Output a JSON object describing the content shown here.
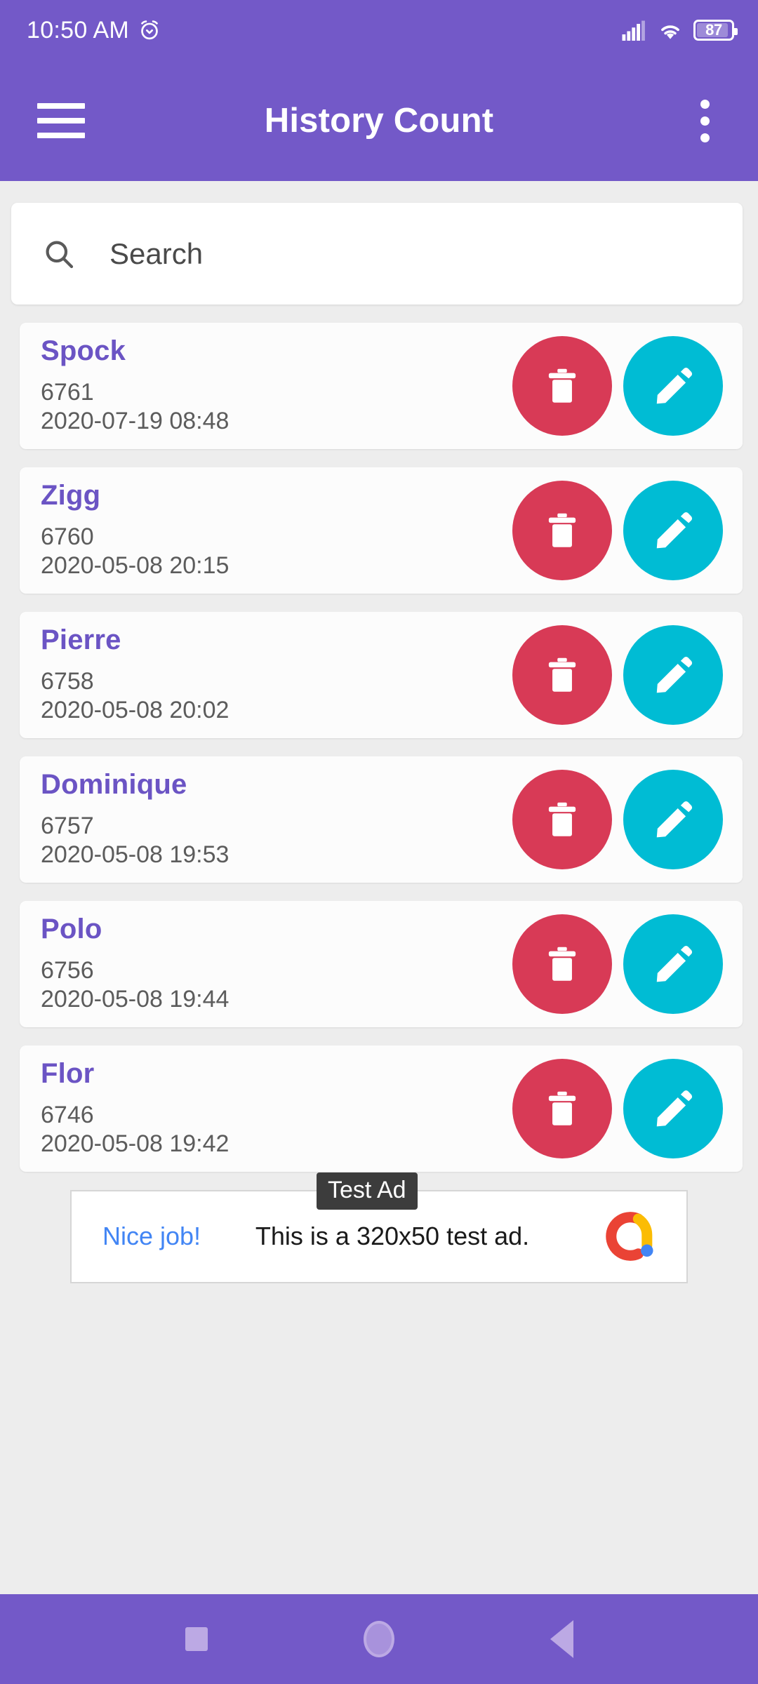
{
  "status_bar": {
    "time": "10:50 AM",
    "alarm_icon": "alarm-icon",
    "signal_icon": "cellular-signal-icon",
    "wifi_icon": "wifi-icon",
    "battery_level": "87"
  },
  "app_bar": {
    "menu_icon": "hamburger-menu-icon",
    "title": "History Count",
    "overflow_icon": "overflow-menu-icon"
  },
  "search": {
    "icon": "search-icon",
    "placeholder": "Search",
    "value": ""
  },
  "list": {
    "items": [
      {
        "name": "Spock",
        "id": "6761",
        "date": "2020-07-19 08:48",
        "delete_icon": "trash-icon",
        "edit_icon": "pencil-icon"
      },
      {
        "name": "Zigg",
        "id": "6760",
        "date": "2020-05-08 20:15",
        "delete_icon": "trash-icon",
        "edit_icon": "pencil-icon"
      },
      {
        "name": "Pierre",
        "id": "6758",
        "date": "2020-05-08 20:02",
        "delete_icon": "trash-icon",
        "edit_icon": "pencil-icon"
      },
      {
        "name": "Dominique",
        "id": "6757",
        "date": "2020-05-08 19:53",
        "delete_icon": "trash-icon",
        "edit_icon": "pencil-icon"
      },
      {
        "name": "Polo",
        "id": "6756",
        "date": "2020-05-08 19:44",
        "delete_icon": "trash-icon",
        "edit_icon": "pencil-icon"
      },
      {
        "name": "Flor",
        "id": "6746",
        "date": "2020-05-08 19:42",
        "delete_icon": "trash-icon",
        "edit_icon": "pencil-icon"
      }
    ]
  },
  "ad": {
    "badge": "Test Ad",
    "cta": "Nice job!",
    "body": "This is a 320x50 test ad.",
    "logo_icon": "admob-logo-icon"
  },
  "nav_bar": {
    "recents_icon": "recents-square-icon",
    "home_icon": "home-circle-icon",
    "back_icon": "back-triangle-icon"
  },
  "colors": {
    "primary_purple": "#7359C8",
    "name_purple": "#6B54C4",
    "delete_red": "#D83A56",
    "edit_cyan": "#00BCD4",
    "page_background": "#EDEDED",
    "card_white": "#FCFCFC",
    "ad_link_blue": "#4285F4"
  }
}
